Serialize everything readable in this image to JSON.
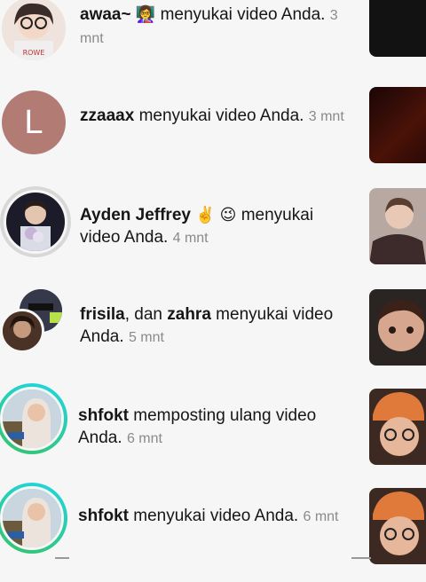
{
  "notifications": [
    {
      "user": "awaa~",
      "user_emoji": "👩‍🏫",
      "action": "menyukai video Anda.",
      "time": "3 mnt",
      "avatar": "photo-girl-glasses",
      "thumb": "video-thumbnail-dark"
    },
    {
      "user": "zzaaax",
      "action": "menyukai video Anda.",
      "time": "3 mnt",
      "avatar_letter": "L",
      "avatar_color": "#b27c74",
      "thumb": "video-thumbnail-red"
    },
    {
      "user": "Ayden Jeffrey",
      "user_emoji": "✌️ 😉",
      "action": "menyukai video Anda.",
      "time": "4 mnt",
      "avatar": "photo-boy-flowers",
      "thumb": "video-thumbnail-face"
    },
    {
      "user": "frisila",
      "joiner": ", dan",
      "user2": "zahra",
      "action": "menyukai video Anda.",
      "time": "5 mnt",
      "avatar": "group-avatars",
      "thumb": "video-thumbnail-boy"
    },
    {
      "user": "shfokt",
      "action": "memposting ulang video Anda.",
      "time": "6 mnt",
      "avatar": "photo-hijab-girl",
      "thumb": "video-thumbnail-beanie"
    },
    {
      "user": "shfokt",
      "action": "menyukai video Anda.",
      "time": "6 mnt",
      "avatar": "photo-hijab-girl",
      "thumb": "video-thumbnail-beanie"
    }
  ],
  "colors": {
    "story_ring_start": "#1fd6e4",
    "story_ring_end": "#36c46a",
    "text": "#161616",
    "time": "#8a8a8a"
  }
}
